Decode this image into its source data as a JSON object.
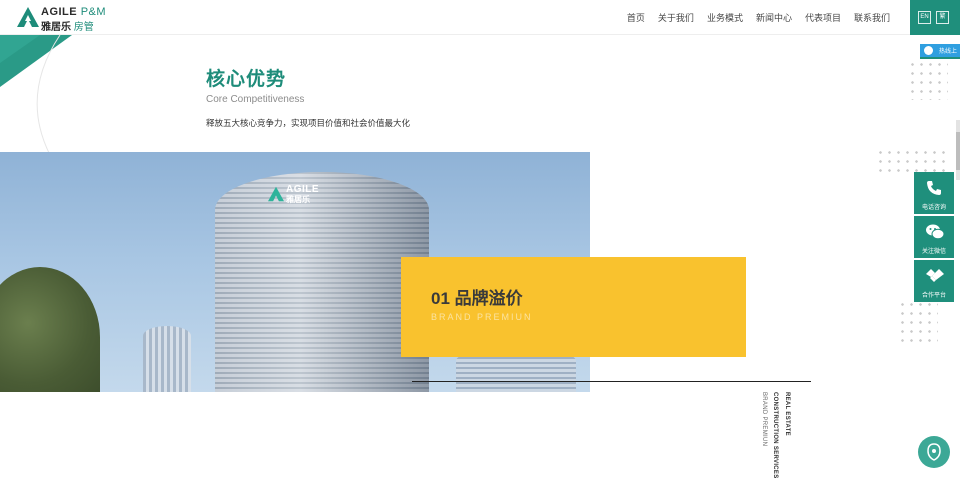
{
  "header": {
    "logo_en": "AGILE",
    "logo_pm": "P&M",
    "logo_cn": "雅居乐",
    "logo_cn2": "房管",
    "nav": [
      {
        "label": "首页"
      },
      {
        "label": "关于我们"
      },
      {
        "label": "业务模式"
      },
      {
        "label": "新闻中心"
      },
      {
        "label": "代表项目"
      },
      {
        "label": "联系我们"
      }
    ],
    "lang_en": "EN",
    "lang_cn": "繁"
  },
  "badge": {
    "label": "热线上"
  },
  "section": {
    "title": "核心优势",
    "subtitle": "Core Competitiveness",
    "description": "释放五大核心竞争力，实现项目价值和社会价值最大化"
  },
  "hero": {
    "building_logo_en": "AGILE",
    "building_logo_cn": "雅居乐"
  },
  "card": {
    "title": "01 品牌溢价",
    "subtitle": "BRAND PREMIUN"
  },
  "vertical_text": {
    "line1": "REAL ESTATE",
    "line2": "CONSTRUCTION SERVICES",
    "line3": "BRAND PREMIUN"
  },
  "float_panel": [
    {
      "label": "电话咨询",
      "icon": "phone-icon"
    },
    {
      "label": "关注微信",
      "icon": "wechat-icon"
    },
    {
      "label": "合作平台",
      "icon": "handshake-icon"
    }
  ],
  "colors": {
    "brand_green": "#1f8f7c",
    "card_yellow": "#f9c22e",
    "badge_blue": "#2f9fe0"
  }
}
